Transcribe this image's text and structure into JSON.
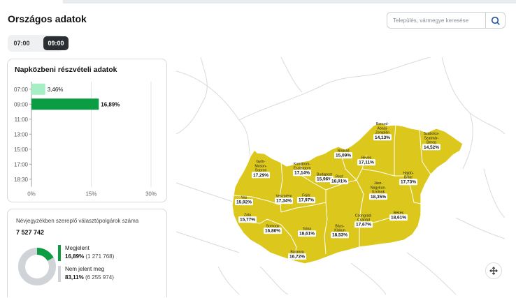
{
  "title": "Országos adatok",
  "search": {
    "placeholder": "Település, vármegye keresése",
    "icon": "search-icon"
  },
  "time_toggle": [
    {
      "label": "07:00",
      "active": false
    },
    {
      "label": "09:00",
      "active": true
    }
  ],
  "turnout_card": {
    "title": "Napközbeni részvételi adatok",
    "chart_data": {
      "type": "bar",
      "orientation": "horizontal",
      "categories": [
        "07:00",
        "09:00",
        "11:00",
        "13:00",
        "15:00",
        "17:00",
        "18:30"
      ],
      "values": [
        3.46,
        16.89,
        null,
        null,
        null,
        null,
        null
      ],
      "value_labels": [
        "3,46%",
        "16,89%",
        "",
        "",
        "",
        "",
        ""
      ],
      "xticks": [
        "0%",
        "15%",
        "30%"
      ],
      "xlim": [
        0,
        30
      ],
      "colors": [
        "#a6eec4",
        "#0a9d43"
      ]
    }
  },
  "voters_card": {
    "title": "Névjegyzékben szereplő választópolgárok száma",
    "total": "7 527 742",
    "appeared": {
      "label": "Megjelent",
      "percent": "16,89%",
      "count": "(1 271 768)",
      "value": 16.89,
      "color": "#0a9d43"
    },
    "not_appeared": {
      "label": "Nem jelent meg",
      "percent": "83,11%",
      "count": "(6 255 974)",
      "value": 83.11,
      "color": "#d0d4d8"
    }
  },
  "map": {
    "fill_color": "#dcc81c",
    "labels": [
      {
        "name": "Borsod-\nAbaúj-\nZemplén",
        "value": "14,13%"
      },
      {
        "name": "Szabolcs-\nSzatmár-\nBereg",
        "value": "14,52%"
      },
      {
        "name": "Nógrád",
        "value": "15,09%"
      },
      {
        "name": "Heves",
        "value": "17,11%"
      },
      {
        "name": "Győr-\nMoson-\nSopron",
        "value": "17,29%"
      },
      {
        "name": "Komárom-\nEsztergom",
        "value": "17,14%"
      },
      {
        "name": "Budapest",
        "value": "15,96%"
      },
      {
        "name": "Pest",
        "value": "18,01%"
      },
      {
        "name": "Hajdú-\nBihar",
        "value": "17,73%"
      },
      {
        "name": "Jász-\nNagykun-\nSzolnok",
        "value": "18,35%"
      },
      {
        "name": "Vas",
        "value": "15,92%"
      },
      {
        "name": "Veszprém",
        "value": "17,34%"
      },
      {
        "name": "Fejér",
        "value": "17,97%"
      },
      {
        "name": "Zala",
        "value": "15,77%"
      },
      {
        "name": "Somogy",
        "value": "16,86%"
      },
      {
        "name": "Tolna",
        "value": "18,61%"
      },
      {
        "name": "Bács-\nKiskun",
        "value": "18,53%"
      },
      {
        "name": "Csongrád-\nCsanád",
        "value": "17,67%"
      },
      {
        "name": "Békés",
        "value": "18,61%"
      },
      {
        "name": "Baranya",
        "value": "16,72%"
      }
    ]
  }
}
